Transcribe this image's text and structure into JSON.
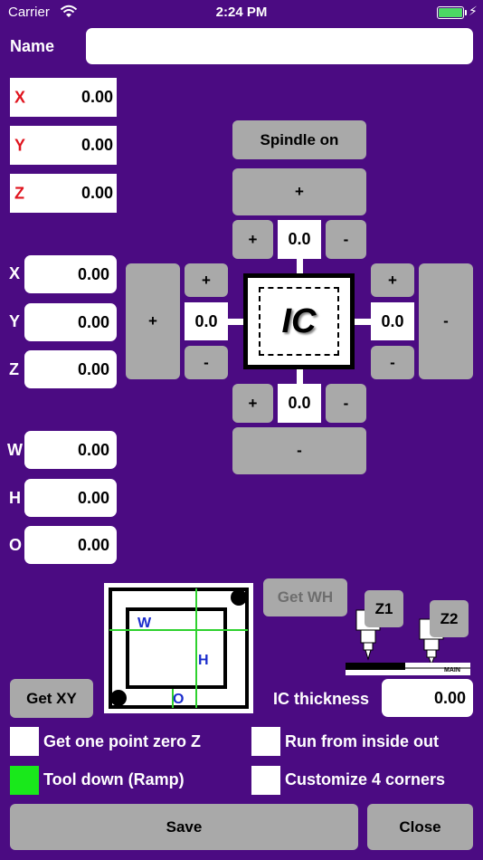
{
  "status_bar": {
    "carrier": "Carrier",
    "time": "2:24 PM"
  },
  "name_field": {
    "label": "Name",
    "value": ""
  },
  "machine_coords": [
    {
      "axis": "X",
      "value": "0.00"
    },
    {
      "axis": "Y",
      "value": "0.00"
    },
    {
      "axis": "Z",
      "value": "0.00"
    }
  ],
  "work_coords": [
    {
      "axis": "X",
      "value": "0.00"
    },
    {
      "axis": "Y",
      "value": "0.00"
    },
    {
      "axis": "Z",
      "value": "0.00"
    }
  ],
  "dimensions": [
    {
      "axis": "W",
      "value": "0.00"
    },
    {
      "axis": "H",
      "value": "0.00"
    },
    {
      "axis": "O",
      "value": "0.00"
    }
  ],
  "jog": {
    "spindle_label": "Spindle on",
    "plus": "+",
    "minus": "-",
    "top_value": "0.0",
    "bottom_value": "0.0",
    "left_value": "0.0",
    "right_value": "0.0",
    "chip_label": "IC"
  },
  "diagram": {
    "w_label": "W",
    "h_label": "H",
    "o_label": "O"
  },
  "get_wh_label": "Get WH",
  "get_xy_label": "Get XY",
  "spindles": {
    "z1": "Z1",
    "z2": "Z2",
    "ic_tag": "IC",
    "main_tag": "MAIN"
  },
  "ic_thickness": {
    "label": "IC thickness",
    "value": "0.00"
  },
  "options": [
    {
      "label": "Get one point zero Z",
      "checked": false
    },
    {
      "label": "Run from inside out",
      "checked": false
    },
    {
      "label": "Tool down (Ramp)",
      "checked": true
    },
    {
      "label": "Customize 4 corners",
      "checked": false
    }
  ],
  "footer": {
    "save_label": "Save",
    "close_label": "Close"
  },
  "colors": {
    "background": "#4b0b82",
    "button": "#a9a9a9",
    "axis_red": "#e0141e",
    "checked_green": "#19e81b",
    "diagram_green": "#2ed12e",
    "diagram_blue": "#1a2ccc"
  }
}
